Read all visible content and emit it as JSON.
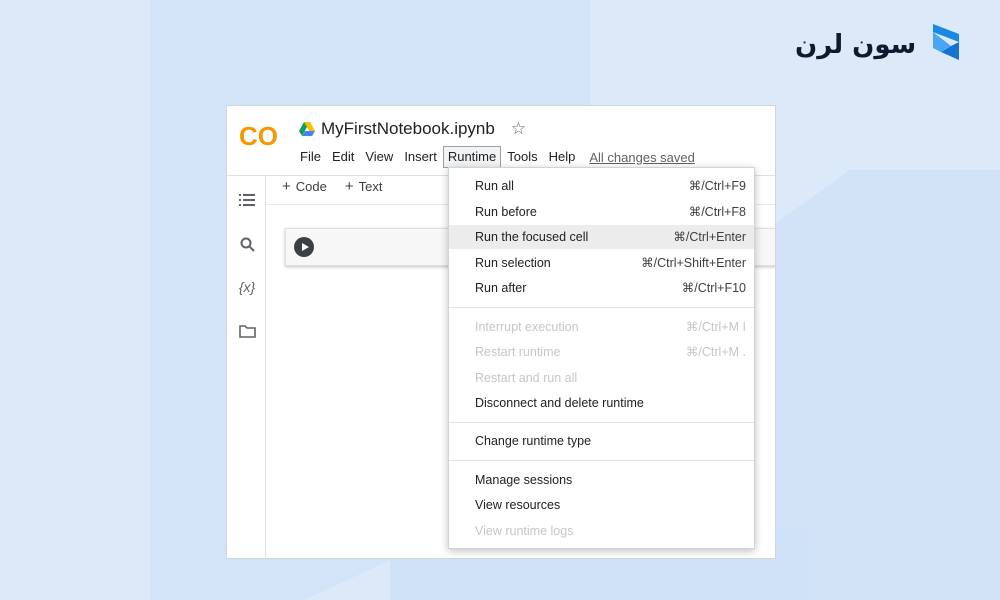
{
  "window": {
    "title": "MyFirstNotebook.ipynb",
    "status": "All changes saved",
    "logo_text": "CO",
    "menu": [
      "File",
      "Edit",
      "View",
      "Insert",
      "Runtime",
      "Tools",
      "Help"
    ],
    "active_menu": "Runtime",
    "toolbar": {
      "code": "Code",
      "text": "Text"
    },
    "sidebar_icons": [
      "toc-icon",
      "search-icon",
      "variables-icon",
      "folder-icon"
    ]
  },
  "brand": {
    "text": "سون لرن",
    "accent": "#1a88e8"
  },
  "runtime_menu": {
    "groups": [
      [
        {
          "label": "Run all",
          "shortcut": "⌘/Ctrl+F9",
          "enabled": true
        },
        {
          "label": "Run before",
          "shortcut": "⌘/Ctrl+F8",
          "enabled": true
        },
        {
          "label": "Run the focused cell",
          "shortcut": "⌘/Ctrl+Enter",
          "enabled": true,
          "highlighted": true
        },
        {
          "label": "Run selection",
          "shortcut": "⌘/Ctrl+Shift+Enter",
          "enabled": true
        },
        {
          "label": "Run after",
          "shortcut": "⌘/Ctrl+F10",
          "enabled": true
        }
      ],
      [
        {
          "label": "Interrupt execution",
          "shortcut": "⌘/Ctrl+M I",
          "enabled": false
        },
        {
          "label": "Restart runtime",
          "shortcut": "⌘/Ctrl+M .",
          "enabled": false
        },
        {
          "label": "Restart and run all",
          "shortcut": "",
          "enabled": false
        },
        {
          "label": "Disconnect and delete runtime",
          "shortcut": "",
          "enabled": true
        }
      ],
      [
        {
          "label": "Change runtime type",
          "shortcut": "",
          "enabled": true
        }
      ],
      [
        {
          "label": "Manage sessions",
          "shortcut": "",
          "enabled": true
        },
        {
          "label": "View resources",
          "shortcut": "",
          "enabled": true
        },
        {
          "label": "View runtime logs",
          "shortcut": "",
          "enabled": false
        }
      ]
    ]
  }
}
